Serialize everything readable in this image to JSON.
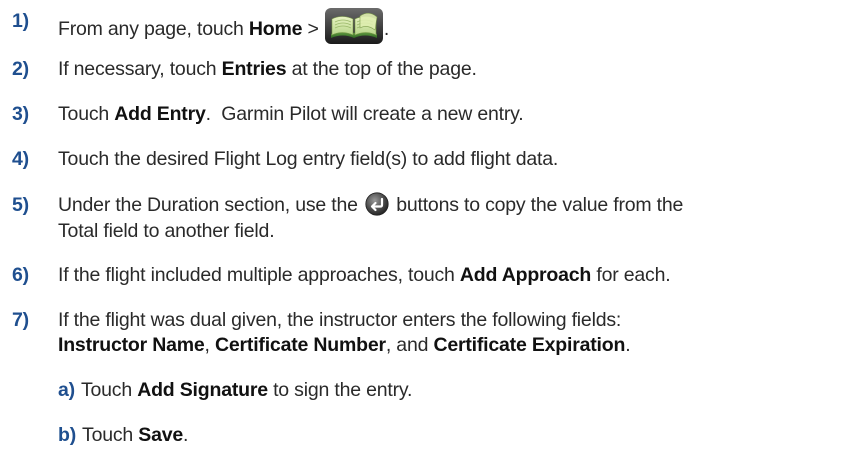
{
  "steps": [
    {
      "number": "1)",
      "before": "From any page, touch ",
      "bold1": "Home",
      "middle": " > ",
      "after": ".",
      "icon": "logbook-icon"
    },
    {
      "number": "2)",
      "before": "If necessary, touch ",
      "bold1": "Entries",
      "after": " at the top of the page."
    },
    {
      "number": "3)",
      "before": "Touch ",
      "bold1": "Add Entry",
      "after": ".  Garmin Pilot will create a new entry."
    },
    {
      "number": "4)",
      "text": "Touch the desired Flight Log entry field(s) to add flight data."
    },
    {
      "number": "5)",
      "before": "Under the Duration section, use the ",
      "after": " buttons to copy the value from the",
      "line2": "Total field to another field.",
      "icon": "enter-icon"
    },
    {
      "number": "6)",
      "before": "If the flight included multiple approaches, touch ",
      "bold1": "Add Approach",
      "after": " for each."
    },
    {
      "number": "7)",
      "line1": "If the flight was dual given, the instructor enters the following fields:",
      "bold1": "Instructor Name",
      "sep1": ", ",
      "bold2": "Certificate Number",
      "sep2": ", and ",
      "bold3": "Certificate Expiration",
      "end": "."
    }
  ],
  "substeps": [
    {
      "label": "a)",
      "before": "Touch ",
      "bold": "Add Signature",
      "after": " to sign the entry."
    },
    {
      "label": "b)",
      "before": "Touch ",
      "bold": "Save",
      "after": "."
    }
  ],
  "colors": {
    "step_number": "#1f4f8f",
    "text": "#2a2a2a"
  }
}
